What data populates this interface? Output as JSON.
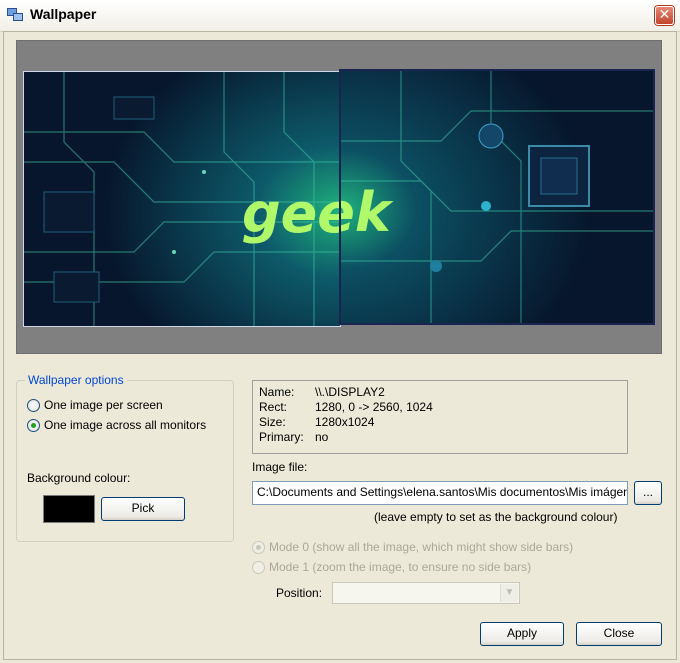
{
  "window": {
    "title": "Wallpaper",
    "close_glyph": "✕"
  },
  "preview": {
    "wallpaper_text": "geek"
  },
  "wallpaper_options": {
    "legend": "Wallpaper options",
    "options": [
      {
        "label": "One image per screen",
        "checked": false
      },
      {
        "label": "One image across all monitors",
        "checked": true
      }
    ],
    "background_colour_label": "Background colour:",
    "background_colour": "#000000",
    "pick_label": "Pick"
  },
  "display_info": {
    "name_key": "Name:",
    "name_value": "\\\\.\\DISPLAY2",
    "rect_key": "Rect:",
    "rect_value": "1280, 0 -> 2560, 1024",
    "size_key": "Size:",
    "size_value": "1280x1024",
    "primary_key": "Primary:",
    "primary_value": "no"
  },
  "image_file": {
    "label": "Image file:",
    "value": "C:\\Documents and Settings\\elena.santos\\Mis documentos\\Mis imágenes\\geek.jpg",
    "browse_label": "...",
    "hint": "(leave empty to set as the background colour)"
  },
  "modes": [
    {
      "label": "Mode 0 (show all the image, which might show side bars)",
      "checked": true
    },
    {
      "label": "Mode 1 (zoom the image, to ensure no side bars)",
      "checked": false
    }
  ],
  "position": {
    "label": "Position:",
    "value": ""
  },
  "buttons": {
    "apply": "Apply",
    "close": "Close"
  },
  "colors": {
    "accent": "#0046d5",
    "disabled": "#aca899"
  }
}
